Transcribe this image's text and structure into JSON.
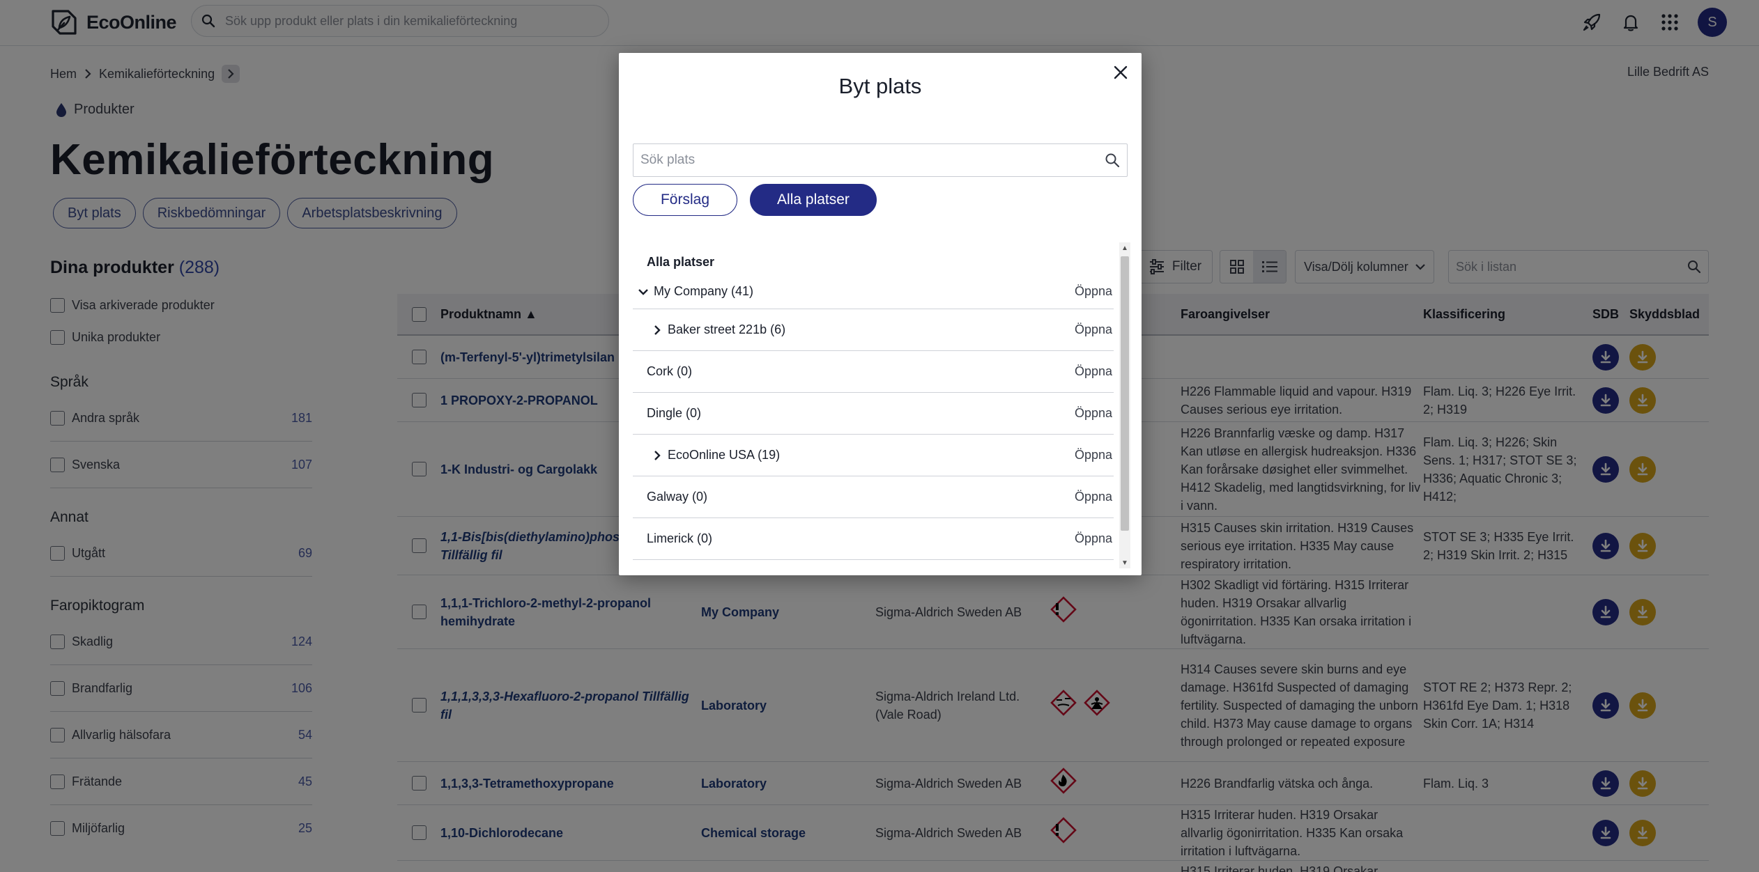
{
  "topbar": {
    "logo_text": "EcoOnline",
    "search_placeholder": "Sök upp produkt eller plats i din kemikalieförteckning",
    "avatar_initial": "S"
  },
  "breadcrumb": {
    "home": "Hem",
    "current": "Kemikalieförteckning"
  },
  "company": "Lille Bedrift AS",
  "section_tag": "Produkter",
  "page_title": "Kemikalieförteckning",
  "action_pills": [
    "Byt plats",
    "Riskbedömningar",
    "Arbetsplatsbeskrivning"
  ],
  "sidebar": {
    "heading": "Dina produkter",
    "count": "(288)",
    "checks": [
      "Visa arkiverade produkter",
      "Unika produkter"
    ],
    "groups": [
      {
        "title": "Språk",
        "items": [
          {
            "label": "Andra språk",
            "count": "181"
          },
          {
            "label": "Svenska",
            "count": "107"
          }
        ]
      },
      {
        "title": "Annat",
        "items": [
          {
            "label": "Utgått",
            "count": "69"
          }
        ]
      },
      {
        "title": "Faropiktogram",
        "items": [
          {
            "label": "Skadlig",
            "count": "124"
          },
          {
            "label": "Brandfarlig",
            "count": "106"
          },
          {
            "label": "Allvarlig hälsofara",
            "count": "54"
          },
          {
            "label": "Frätande",
            "count": "45"
          },
          {
            "label": "Miljöfarlig",
            "count": "25"
          }
        ]
      }
    ]
  },
  "toolbar": {
    "filter_label": "Filter",
    "columns_label": "Visa/Dölj kolumner",
    "list_search_placeholder": "Sök i listan"
  },
  "table": {
    "headers": {
      "name": "Produktnamn ▲",
      "hazard": "Faroangivelser",
      "classification": "Klassificering",
      "sdb": "SDB",
      "sky": "Skyddsblad"
    },
    "rows": [
      {
        "name": "(m-Terfenyl-5'-yl)trimetylsilan",
        "italic": false,
        "place": "",
        "supplier": "",
        "pictograms": [],
        "hazard": "",
        "classification": ""
      },
      {
        "name": "1 PROPOXY-2-PROPANOL",
        "italic": false,
        "place": "",
        "supplier": "",
        "pictograms": [],
        "hazard": "H226 Flammable liquid and vapour. H319 Causes serious eye irritation.",
        "classification": "Flam. Liq. 3; H226 Eye Irrit. 2; H319"
      },
      {
        "name": "1-K Industri- og Cargolakk",
        "italic": false,
        "place": "",
        "supplier": "",
        "pictograms": [],
        "hazard": "H226 Brannfarlig væske og damp. H317 Kan utløse en allergisk hudreaksjon. H336 Kan forårsake døsighet eller svimmelhet. H412 Skadelig, med langtidsvirkning, for liv i vann.",
        "classification": "Flam. Liq. 3; H226; Skin Sens. 1; H317; STOT SE 3; H336; Aquatic Chronic 3; H412;"
      },
      {
        "name": "1,1-Bis[bis(diethylamino)phosphino] Tillfällig fil",
        "italic": true,
        "place": "",
        "supplier": "",
        "pictograms": [],
        "hazard": "H315 Causes skin irritation. H319 Causes serious eye irritation. H335 May cause respiratory irritation.",
        "classification": "STOT SE 3; H335 Eye Irrit. 2; H319 Skin Irrit. 2; H315"
      },
      {
        "name": "1,1,1-Trichloro-2-methyl-2-propanol hemihydrate",
        "italic": false,
        "place": "My Company",
        "supplier": "Sigma-Aldrich Sweden AB",
        "pictograms": [
          "exclamation"
        ],
        "hazard": "H302 Skadligt vid förtäring. H315 Irriterar huden. H319 Orsakar allvarlig ögonirritation. H335 Kan orsaka irritation i luftvägarna.",
        "classification": ""
      },
      {
        "name": "1,1,1,3,3,3-Hexafluoro-2-propanol Tillfällig fil",
        "italic": true,
        "place": "Laboratory",
        "supplier": "Sigma-Aldrich Ireland Ltd. (Vale Road)",
        "pictograms": [
          "corrosive",
          "health"
        ],
        "hazard": "H314 Causes severe skin burns and eye damage. H361fd Suspected of damaging fertility. Suspected of damaging the unborn child. H373 May cause damage to organs through prolonged or repeated exposure",
        "classification": "STOT RE 2; H373 Repr. 2; H361fd Eye Dam. 1; H318 Skin Corr. 1A; H314"
      },
      {
        "name": "1,1,3,3-Tetramethoxypropane",
        "italic": false,
        "place": "Laboratory",
        "supplier": "Sigma-Aldrich Sweden AB",
        "pictograms": [
          "flame"
        ],
        "hazard": "H226 Brandfarlig vätska och ånga.",
        "classification": "Flam. Liq. 3"
      },
      {
        "name": "1,10-Dichlorodecane",
        "italic": false,
        "place": "Chemical storage",
        "supplier": "Sigma-Aldrich Sweden AB",
        "pictograms": [
          "exclamation"
        ],
        "hazard": "H315 Irriterar huden. H319 Orsakar allvarlig ögonirritation. H335 Kan orsaka irritation i luftvägarna.",
        "classification": ""
      },
      {
        "name": "",
        "italic": false,
        "place": "",
        "supplier": "",
        "pictograms": [],
        "hazard": "H315 Irriterar huden. H319 Orsakar",
        "classification": ""
      }
    ]
  },
  "modal": {
    "title": "Byt plats",
    "search_placeholder": "Sök plats",
    "tab_suggestions": "Förslag",
    "tab_all": "Alla platser",
    "tree_heading": "Alla platser",
    "open_label": "Öppna",
    "items": [
      {
        "label": "My Company (41)",
        "chevron": "down",
        "indent": 0
      },
      {
        "label": "Baker street 221b (6)",
        "chevron": "right",
        "indent": 1
      },
      {
        "label": "Cork (0)",
        "chevron": "none",
        "indent": 1
      },
      {
        "label": "Dingle (0)",
        "chevron": "none",
        "indent": 1
      },
      {
        "label": "EcoOnline USA (19)",
        "chevron": "right",
        "indent": 1
      },
      {
        "label": "Galway (0)",
        "chevron": "none",
        "indent": 1
      },
      {
        "label": "Limerick (0)",
        "chevron": "none",
        "indent": 1
      }
    ]
  },
  "colors": {
    "brand_navy": "#232b85",
    "link_blue": "#1e3a7a",
    "download_gold": "#d7a41b",
    "hazard_red": "#c8102e"
  }
}
